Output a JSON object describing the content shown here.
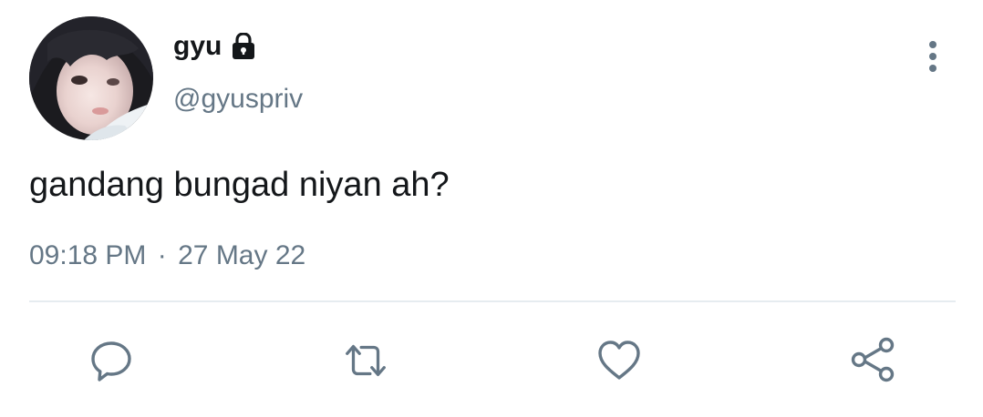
{
  "tweet": {
    "display_name": "gyu",
    "handle": "@gyuspriv",
    "text": "gandang bungad niyan ah?",
    "time": "09:18 PM",
    "separator": "·",
    "date": "27 May 22"
  },
  "icons": {
    "avatar": "profile-photo",
    "lock": "lock-icon",
    "more": "more-vertical-icon",
    "reply": "reply-icon",
    "retweet": "retweet-icon",
    "like": "heart-icon",
    "share": "share-icon"
  },
  "colors": {
    "text_primary": "#14171a",
    "text_secondary": "#657786",
    "divider": "#e6ecf0",
    "icon": "#657786"
  }
}
